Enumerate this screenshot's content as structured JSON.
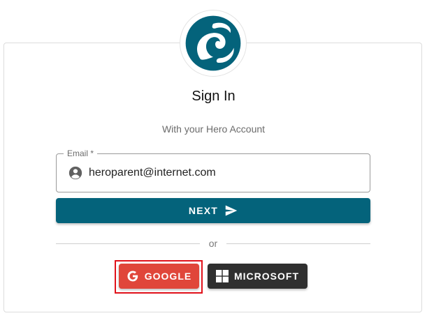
{
  "heading": "Sign In",
  "subheading": "With your Hero Account",
  "email_field": {
    "label": "Email *",
    "value": "heroparent@internet.com"
  },
  "next_button": {
    "label": "NEXT",
    "icon": "send-icon"
  },
  "divider_text": "or",
  "google_button": {
    "label": "GOOGLE",
    "icon": "google-icon"
  },
  "microsoft_button": {
    "label": "MICROSOFT",
    "icon": "microsoft-icon"
  },
  "colors": {
    "brand": "#04637b",
    "google": "#e0463a",
    "microsoft": "#2f2f2f",
    "highlight": "#e0111a"
  }
}
